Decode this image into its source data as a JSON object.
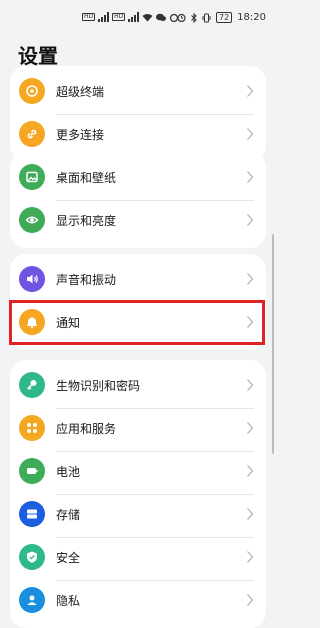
{
  "status_bar": {
    "battery": "72",
    "time": "18:20"
  },
  "page_title": "设置",
  "cards": [
    {
      "items": [
        {
          "id": "super-terminal",
          "label": "超级终端",
          "icon": "super-terminal-icon",
          "color": "#f5a623"
        },
        {
          "id": "more-connections",
          "label": "更多连接",
          "icon": "link-icon",
          "color": "#f5a623"
        }
      ]
    },
    {
      "items": [
        {
          "id": "wallpaper",
          "label": "桌面和壁纸",
          "icon": "image-icon",
          "color": "#3dab57"
        },
        {
          "id": "display",
          "label": "显示和亮度",
          "icon": "eye-icon",
          "color": "#3dab57"
        }
      ]
    },
    {
      "items": [
        {
          "id": "sound",
          "label": "声音和振动",
          "icon": "speaker-icon",
          "color": "#6e54e0"
        },
        {
          "id": "notifications",
          "label": "通知",
          "icon": "bell-icon",
          "color": "#f5a623"
        }
      ]
    },
    {
      "items": [
        {
          "id": "biometrics",
          "label": "生物识别和密码",
          "icon": "key-icon",
          "color": "#2fb88a"
        },
        {
          "id": "apps",
          "label": "应用和服务",
          "icon": "apps-grid-icon",
          "color": "#f5a623"
        },
        {
          "id": "battery",
          "label": "电池",
          "icon": "battery-icon",
          "color": "#3dab57"
        },
        {
          "id": "storage",
          "label": "存储",
          "icon": "storage-icon",
          "color": "#1a5fe0"
        },
        {
          "id": "security",
          "label": "安全",
          "icon": "shield-icon",
          "color": "#2fb88a"
        },
        {
          "id": "privacy",
          "label": "隐私",
          "icon": "privacy-icon",
          "color": "#1a8fe0"
        }
      ]
    }
  ],
  "highlighted_item": "notifications"
}
